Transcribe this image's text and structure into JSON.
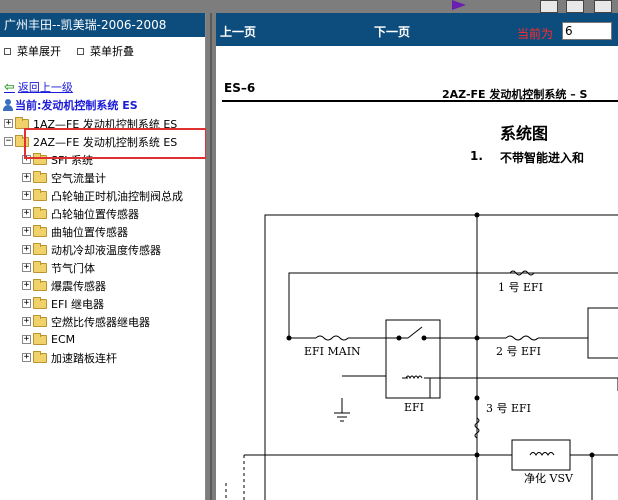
{
  "window": {
    "title": "广州丰田--凯美瑞-2006-2008"
  },
  "menu": {
    "expand_label": "菜单展开",
    "collapse_label": "菜单折叠"
  },
  "tree": {
    "back_label": "返回上一级",
    "current_label": "当前:发动机控制系统 ES",
    "items": [
      {
        "label": "1AZ—FE 发动机控制系统 ES",
        "level": 1,
        "expander": "+"
      },
      {
        "label": "2AZ—FE 发动机控制系统 ES",
        "level": 1,
        "expander": "−"
      },
      {
        "label": "SFI 系统",
        "level": 2,
        "expander": "+"
      },
      {
        "label": "空气流量计",
        "level": 2,
        "expander": "+"
      },
      {
        "label": "凸轮轴正时机油控制阀总成",
        "level": 2,
        "expander": "+"
      },
      {
        "label": "凸轮轴位置传感器",
        "level": 2,
        "expander": "+"
      },
      {
        "label": "曲轴位置传感器",
        "level": 2,
        "expander": "+"
      },
      {
        "label": "动机冷却液温度传感器",
        "level": 2,
        "expander": "+"
      },
      {
        "label": "节气门体",
        "level": 2,
        "expander": "+"
      },
      {
        "label": "爆震传感器",
        "level": 2,
        "expander": "+"
      },
      {
        "label": "EFI 继电器",
        "level": 2,
        "expander": "+"
      },
      {
        "label": "空燃比传感器继电器",
        "level": 2,
        "expander": "+"
      },
      {
        "label": "ECM",
        "level": 2,
        "expander": "+"
      },
      {
        "label": "加速踏板连杆",
        "level": 2,
        "expander": "+"
      }
    ]
  },
  "nav": {
    "prev_label": "上一页",
    "next_label": "下一页",
    "current_page_label": "当前为",
    "current_page_value": "6"
  },
  "document": {
    "page_code": "ES–6",
    "header_right": "2AZ-FE 发动机控制系统 –  S",
    "title": "系统图",
    "sub_number": "1.",
    "sub_title": "不带智能进入和",
    "diagram": {
      "efi_main": "EFI MAIN",
      "efi_relay": "EFI",
      "fuse_1": "1 号 EFI",
      "fuse_2": "2 号 EFI",
      "fuse_3": "3 号 EFI",
      "vsv": "净化 VSV"
    }
  },
  "colors": {
    "title_bar": "#0c4d7e",
    "link": "#1a1ad8",
    "highlight_box": "#e03030",
    "page_label": "#ff2a2a",
    "splitter": "#7d7d7d"
  }
}
